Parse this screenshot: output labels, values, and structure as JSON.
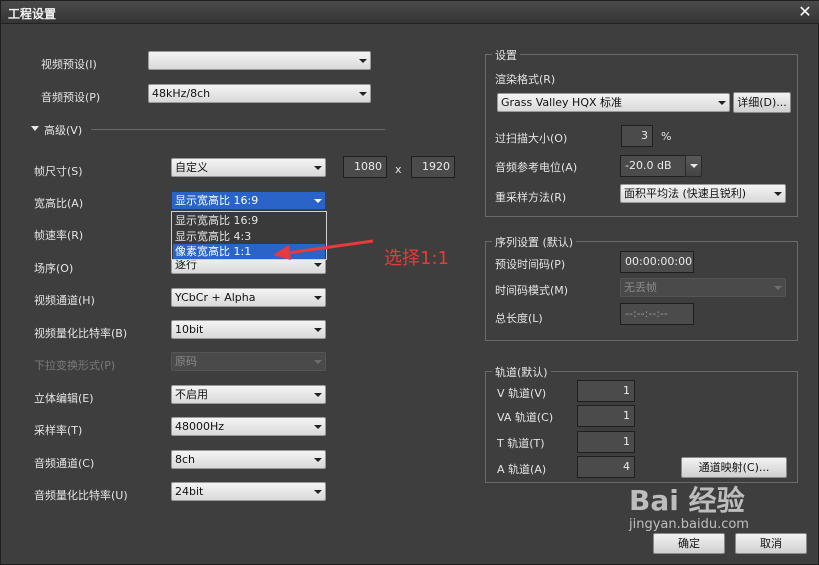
{
  "window": {
    "title": "工程设置",
    "close_glyph": "✕"
  },
  "left": {
    "video_preset": {
      "label": "视频预设(I)",
      "value": ""
    },
    "audio_preset": {
      "label": "音频预设(P)",
      "value": "48kHz/8ch"
    },
    "advanced": {
      "label": "高级(V)"
    },
    "frame_size": {
      "label": "帧尺寸(S)",
      "value": "自定义",
      "width": "1080",
      "x": "x",
      "height": "1920"
    },
    "aspect_ratio": {
      "label": "宽高比(A)",
      "value": "显示宽高比 16:9"
    },
    "frame_rate": {
      "label": "帧速率(R)"
    },
    "field_order": {
      "label": "场序(O)",
      "value": "逐行"
    },
    "video_channel": {
      "label": "视频通道(H)",
      "value": "YCbCr + Alpha"
    },
    "video_quant": {
      "label": "视频量化比特率(B)",
      "value": "10bit"
    },
    "pulldown": {
      "label": "下拉变换形式(P)",
      "value": "原码"
    },
    "stereo_edit": {
      "label": "立体编辑(E)",
      "value": "不启用"
    },
    "sample_rate": {
      "label": "采样率(T)",
      "value": "48000Hz"
    },
    "audio_channel": {
      "label": "音频通道(C)",
      "value": "8ch"
    },
    "audio_quant": {
      "label": "音频量化比特率(U)",
      "value": "24bit"
    }
  },
  "dropdown": {
    "items": [
      "显示宽高比 16:9",
      "显示宽高比 4:3",
      "像素宽高比 1:1"
    ],
    "active_index": 2
  },
  "annotation": {
    "text": "选择1:1",
    "color": "#e83a3a"
  },
  "settings": {
    "title": "设置",
    "render_format": {
      "label": "渲染格式(R)",
      "value": "Grass Valley HQX 标准",
      "details_button": "详细(D)..."
    },
    "overscan": {
      "label": "过扫描大小(O)",
      "value": "3",
      "unit": "%"
    },
    "audio_ref": {
      "label": "音频参考电位(A)",
      "value": "-20.0 dB"
    },
    "resample": {
      "label": "重采样方法(R)",
      "value": "面积平均法 (快速且锐利)"
    }
  },
  "sequence": {
    "title": "序列设置 (默认)",
    "preset_timecode": {
      "label": "预设时间码(P)",
      "value": "00:00:00:00"
    },
    "timecode_mode": {
      "label": "时间码模式(M)",
      "value": "无丢帧"
    },
    "total_length": {
      "label": "总长度(L)",
      "value": "--:--:--:--"
    }
  },
  "tracks": {
    "title": "轨道(默认)",
    "v": {
      "label": "V 轨道(V)",
      "value": "1"
    },
    "va": {
      "label": "VA 轨道(C)",
      "value": "1"
    },
    "t": {
      "label": "T 轨道(T)",
      "value": "1"
    },
    "a": {
      "label": "A 轨道(A)",
      "value": "4"
    },
    "mapping_button": "通道映射(C)..."
  },
  "footer": {
    "ok": "确定",
    "cancel": "取消"
  },
  "watermark": {
    "main": "Bai 经验",
    "sub": "jingyan.baidu.com"
  },
  "colors": {
    "selection": "#2a64c8",
    "annotation_red": "#e83a3a",
    "dialog_bg": "#3e3e3e"
  }
}
